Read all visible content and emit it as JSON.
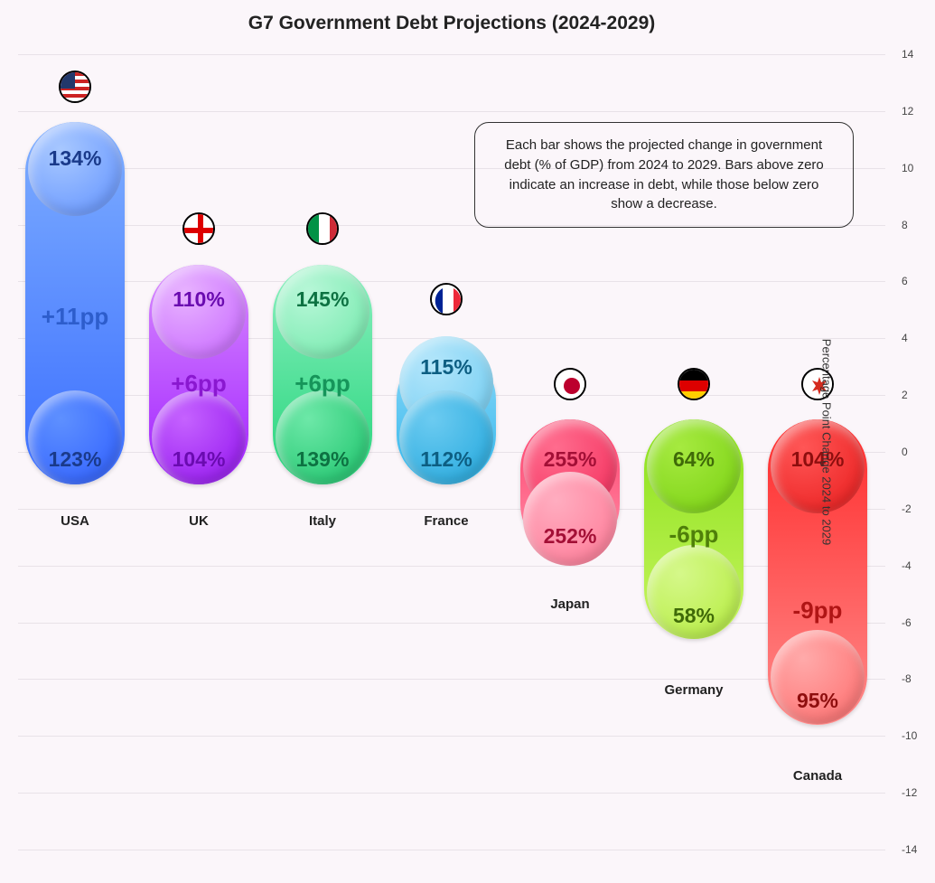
{
  "chart_data": {
    "type": "bar",
    "title": "G7 Government Debt Projections (2024-2029)",
    "ylabel": "Percentage Point Change 2024 to 2029",
    "ylim": [
      -14,
      14
    ],
    "ticks": [
      14,
      12,
      10,
      8,
      6,
      4,
      2,
      0,
      -2,
      -4,
      -6,
      -8,
      -10,
      -12,
      -14
    ],
    "annotation": "Each bar shows the projected change in government debt (% of GDP) from 2024 to 2029. Bars above zero indicate an increase in debt, while those below zero show a decrease.",
    "series": [
      {
        "country": "USA",
        "change": 11,
        "change_label": "+11pp",
        "debt_2024": "123%",
        "debt_2029": "134%"
      },
      {
        "country": "UK",
        "change": 6,
        "change_label": "+6pp",
        "debt_2024": "104%",
        "debt_2029": "110%"
      },
      {
        "country": "Italy",
        "change": 6,
        "change_label": "+6pp",
        "debt_2024": "139%",
        "debt_2029": "145%"
      },
      {
        "country": "France",
        "change": 3,
        "change_label": "",
        "debt_2024": "112%",
        "debt_2029": "115%"
      },
      {
        "country": "Japan",
        "change": -3,
        "change_label": "",
        "debt_2024": "255%",
        "debt_2029": "252%"
      },
      {
        "country": "Germany",
        "change": -6,
        "change_label": "-6pp",
        "debt_2024": "64%",
        "debt_2029": "58%"
      },
      {
        "country": "Canada",
        "change": -9,
        "change_label": "-9pp",
        "debt_2024": "104%",
        "debt_2029": "95%"
      }
    ]
  }
}
